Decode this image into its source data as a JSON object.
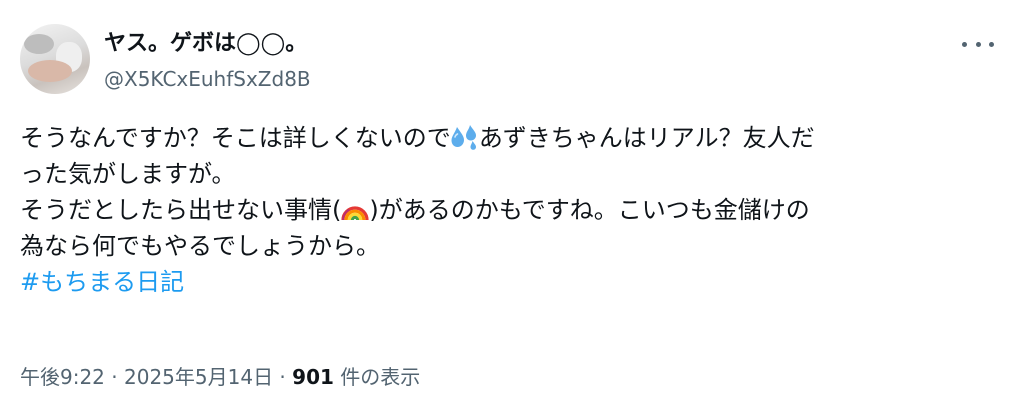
{
  "author": {
    "display_name": "ヤス。ゲボは◯◯。",
    "handle": "@X5KCxEuhfSxZd8B",
    "avatar_icon": "user-avatar-photo"
  },
  "more_icon": "more-options-icon",
  "body": {
    "line1_a": "そうなんですか？そこは詳しくないので",
    "line1_emoji": "sweat-droplets-emoji",
    "line1_b": "あずきちゃんはリアル？友人だ",
    "line2": "った気がしますが。",
    "line3_a": "そうだとしたら出せない事情(",
    "line3_emoji": "rainbow-emoji",
    "line3_b": ")があるのかもですね。こいつも金儲けの",
    "line4": "為なら何でもやるでしょうから。",
    "hashtag": "#もちまる日記"
  },
  "meta": {
    "time": "午後9:22",
    "separator": " · ",
    "date": "2025年5月14日",
    "views_count": "901",
    "views_label": " 件の表示"
  },
  "colors": {
    "link": "#1d9bf0",
    "secondary_text": "#536471",
    "primary_text": "#0f1419"
  }
}
